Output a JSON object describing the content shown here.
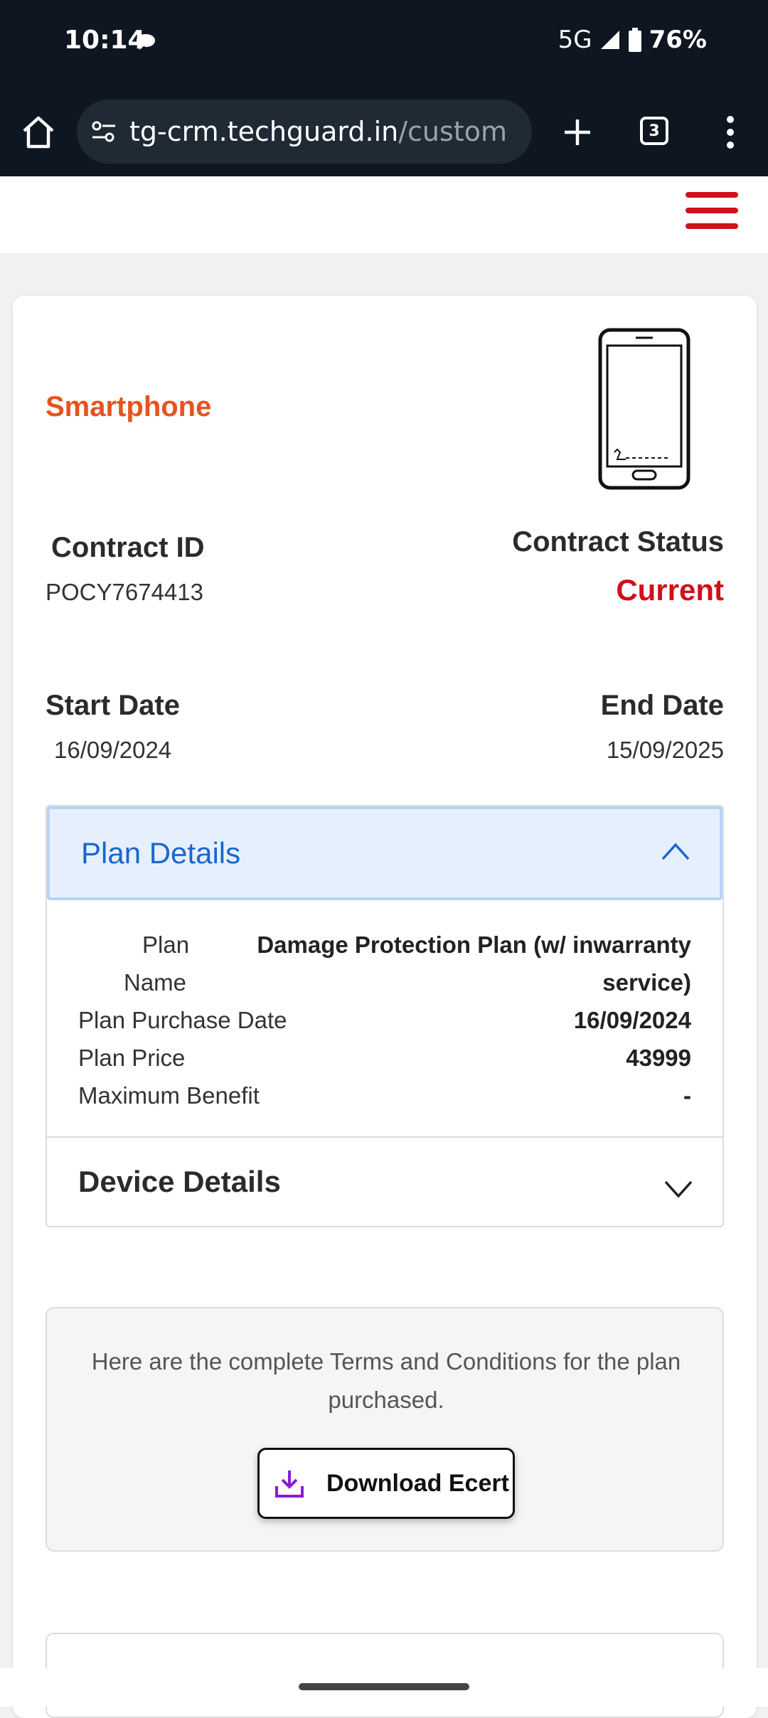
{
  "status_bar": {
    "time": "10:14",
    "network": "5G",
    "battery": "76%"
  },
  "browser": {
    "url_main": "tg-crm.techguard.in",
    "url_rest": "/custom",
    "tab_count": "3"
  },
  "product": {
    "type": "Smartphone"
  },
  "contract": {
    "id_label": "Contract ID",
    "id_value": "POCY7674413",
    "status_label": "Contract Status",
    "status_value": "Current",
    "start_label": "Start Date",
    "start_value": "16/09/2024",
    "end_label": "End Date",
    "end_value": "15/09/2025"
  },
  "plan_details": {
    "title": "Plan Details",
    "plan_name_label_1": "Plan",
    "plan_name_label_2": "Name",
    "plan_name_value_1": "Damage Protection Plan (w/ inwarranty",
    "plan_name_value_2": "service)",
    "purchase_date_label": "Plan Purchase Date",
    "purchase_date_value": "16/09/2024",
    "price_label": "Plan Price",
    "price_value": "43999",
    "max_benefit_label": "Maximum Benefit",
    "max_benefit_value": "-"
  },
  "device_details": {
    "title": "Device Details"
  },
  "terms": {
    "text": "Here are the complete Terms and Conditions for the plan purchased.",
    "button_label": "Download Ecert"
  },
  "colors": {
    "accent_red": "#d0101a",
    "device_orange": "#e6531d",
    "plan_blue": "#1a66d0"
  }
}
